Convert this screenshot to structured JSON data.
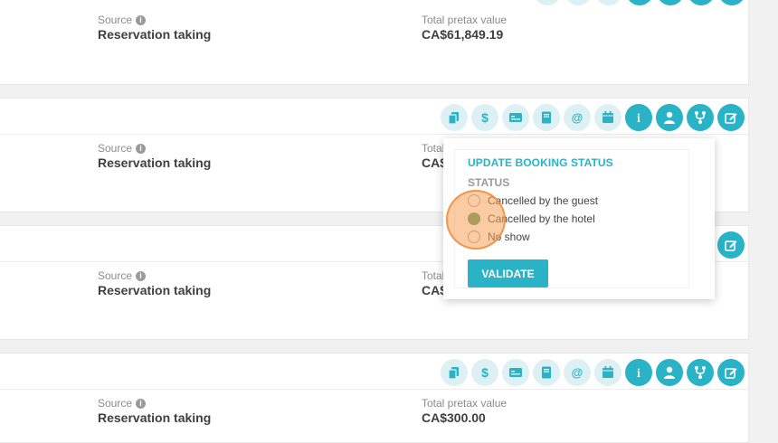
{
  "cards": [
    {
      "source_label": "Source",
      "source_value": "Reservation taking",
      "total_label": "Total pretax value",
      "total_value": "CA$61,849.19"
    },
    {
      "source_label": "Source",
      "source_value": "Reservation taking",
      "total_label": "Total pretax value",
      "total_value": "CA$"
    },
    {
      "source_label": "Source",
      "source_value": "Reservation taking",
      "total_label": "Total pretax value",
      "total_value": "CA$"
    },
    {
      "source_label": "Source",
      "source_value": "Reservation taking",
      "total_label": "Total pretax value",
      "total_value": "CA$300.00"
    }
  ],
  "action_icons": [
    "copy-icon",
    "dollar-icon",
    "card-icon",
    "book-icon",
    "at-icon",
    "calendar-icon",
    "info-icon",
    "user-icon",
    "branch-icon",
    "edit-icon"
  ],
  "popover": {
    "title": "UPDATE BOOKING STATUS",
    "status_label": "STATUS",
    "options": [
      "Cancelled by the guest",
      "Cancelled by the hotel",
      "No show"
    ],
    "selected_index": 1,
    "validate_label": "VALIDATE"
  },
  "colors": {
    "accent": "#2ab3c6",
    "accent_light": "#ddf1f4",
    "radio_checked": "#4e9a62",
    "highlight": "#f7a05a"
  }
}
